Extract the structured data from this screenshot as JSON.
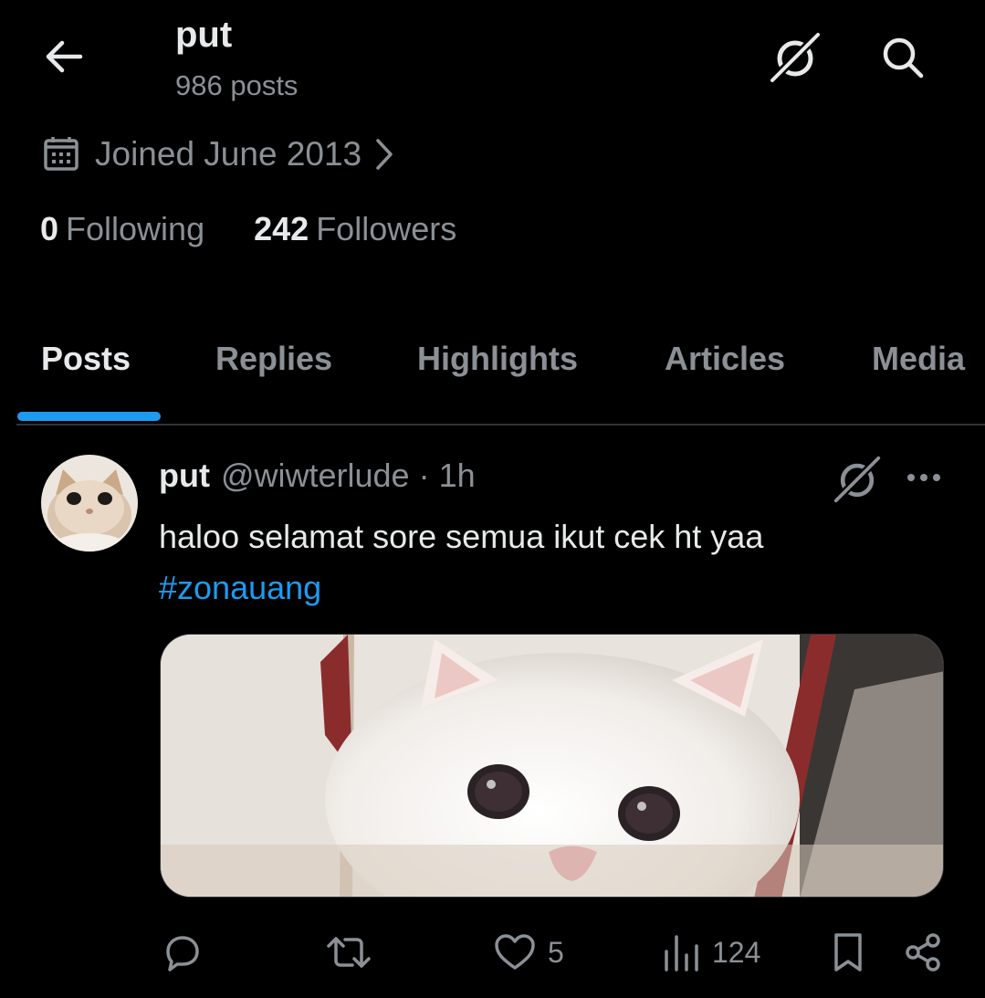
{
  "header": {
    "title": "put",
    "post_count": "986 posts"
  },
  "profile": {
    "joined": "Joined June 2013",
    "following_count": "0",
    "following_label": "Following",
    "followers_count": "242",
    "followers_label": "Followers"
  },
  "tabs": [
    {
      "label": "Posts",
      "active": true
    },
    {
      "label": "Replies",
      "active": false
    },
    {
      "label": "Highlights",
      "active": false
    },
    {
      "label": "Articles",
      "active": false
    },
    {
      "label": "Media",
      "active": false
    }
  ],
  "post": {
    "name": "put",
    "handle": "@wiwterlude",
    "separator": "·",
    "time": "1h",
    "text": "haloo selamat sore semua ikut cek ht yaa",
    "hashtag": "#zonauang",
    "likes": "5",
    "views": "124"
  },
  "icons": {
    "back": "arrow-left-icon",
    "grok": "grok-icon",
    "search": "search-icon",
    "calendar": "calendar-icon",
    "chevron": "chevron-right-icon",
    "more": "more-icon",
    "reply": "reply-icon",
    "repost": "repost-icon",
    "like": "heart-icon",
    "views": "views-icon",
    "bookmark": "bookmark-icon",
    "share": "share-icon"
  },
  "colors": {
    "accent": "#1d9bf0",
    "background": "#000000",
    "text": "#e7e9ea",
    "muted": "#8b9096"
  }
}
